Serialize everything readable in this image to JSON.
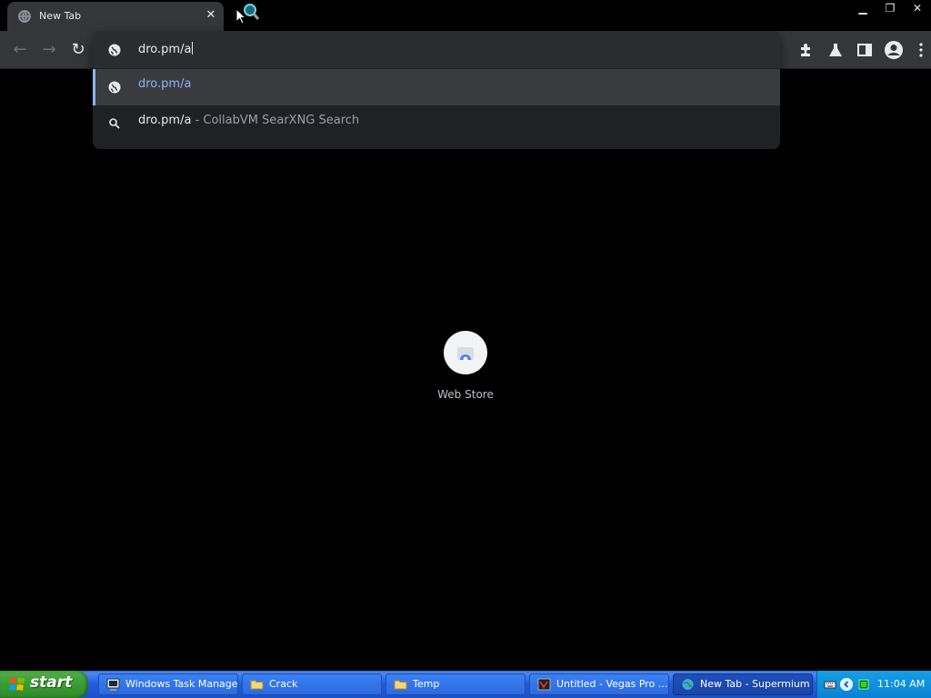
{
  "browser": {
    "tab": {
      "title": "New Tab",
      "close_glyph": "✕"
    },
    "window_controls": {
      "minimize": "▁",
      "restore": "❐",
      "close": "✕"
    },
    "nav": {
      "back": "←",
      "forward": "→",
      "reload": "↻"
    },
    "toolbar_icons": [
      "extensions-icon",
      "labs-icon",
      "side-panel-icon",
      "profile-icon",
      "menu-icon"
    ]
  },
  "omnibox": {
    "value": "dro.pm/a",
    "suggestions": [
      {
        "text": "dro.pm/a",
        "suffix": "",
        "icon": "globe-icon",
        "selected": true
      },
      {
        "text": "dro.pm/a",
        "suffix": " - CollabVM SearXNG Search",
        "icon": "search-icon",
        "selected": false
      }
    ]
  },
  "new_tab_page": {
    "shortcuts": [
      {
        "label": "Web Store",
        "icon": "webstore-icon"
      }
    ]
  },
  "taskbar": {
    "start_label": "start",
    "items": [
      {
        "label": "Windows Task Manager",
        "icon": "task-manager-icon",
        "active": false
      },
      {
        "label": "Crack",
        "icon": "folder-icon",
        "active": false
      },
      {
        "label": "Temp",
        "icon": "folder-icon",
        "active": false
      },
      {
        "label": "Untitled - Vegas Pro ...",
        "icon": "vegas-icon",
        "active": false
      },
      {
        "label": "New Tab - Supermium",
        "icon": "browser-icon",
        "active": true
      }
    ],
    "clock": "11:04 AM"
  },
  "colors": {
    "accent": "#8ab4f8",
    "toolbar": "#35363a",
    "omnibox": "#202124",
    "taskbar": "#245edb",
    "start_button": "#3c9e35"
  }
}
